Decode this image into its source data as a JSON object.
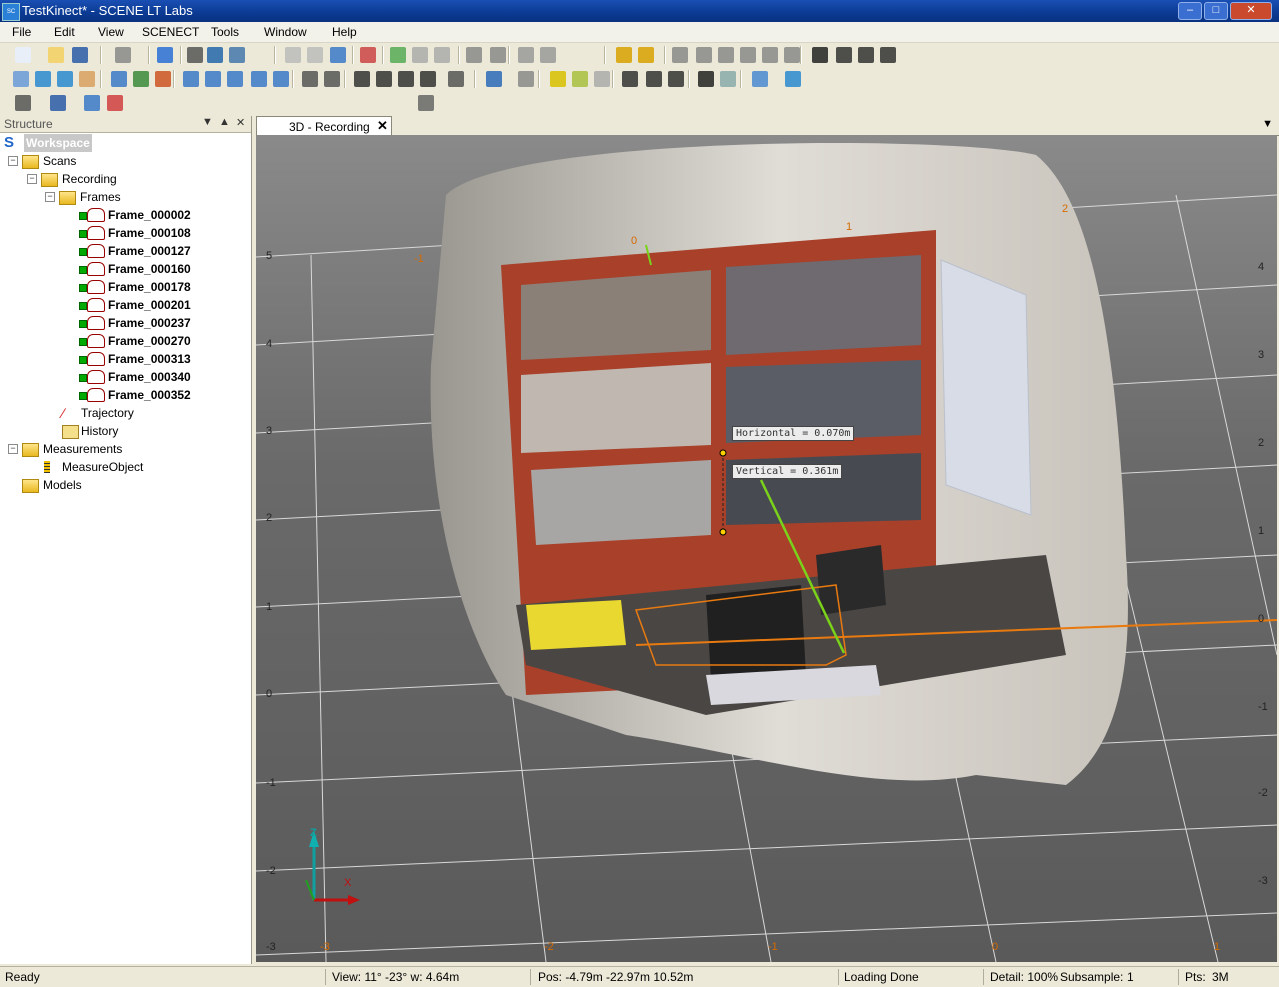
{
  "window": {
    "title": "TestKinect* - SCENE LT Labs",
    "controls": {
      "minimize": "–",
      "maximize": "□",
      "close": "✕"
    }
  },
  "menu": [
    "File",
    "Edit",
    "View",
    "SCENECT",
    "Tools",
    "Window",
    "Help"
  ],
  "structure_panel": {
    "header": "Structure",
    "workspace_label": "Workspace",
    "scans": "Scans",
    "recording": "Recording",
    "frames": "Frames",
    "frame_items": [
      "Frame_000002",
      "Frame_000108",
      "Frame_000127",
      "Frame_000160",
      "Frame_000178",
      "Frame_000201",
      "Frame_000237",
      "Frame_000270",
      "Frame_000313",
      "Frame_000340",
      "Frame_000352"
    ],
    "trajectory": "Trajectory",
    "history": "History",
    "measurements": "Measurements",
    "measure_object": "MeasureObject",
    "models": "Models"
  },
  "tabs": {
    "active_label": "3D - Recording",
    "close_glyph": "✕"
  },
  "viewport": {
    "measurements": {
      "horizontal": "Horizontal = 0.070m",
      "vertical": "Vertical = 0.361m"
    },
    "left_axis_labels": [
      "5",
      "4",
      "3",
      "2",
      "1",
      "0",
      "-1",
      "-2",
      "-3"
    ],
    "right_axis_labels": [
      "4",
      "3",
      "2",
      "1",
      "0",
      "-1",
      "-2",
      "-3"
    ],
    "bottom_axis_labels": [
      "-3",
      "-2",
      "-1",
      "0",
      "1"
    ],
    "top_axis_labels": [
      "-1",
      "0",
      "1",
      "2"
    ],
    "gizmo_z": "Z",
    "gizmo_x": "X"
  },
  "statusbar": {
    "state": "Ready",
    "view": "View: 11° -23° w: 4.64m",
    "pos": "Pos: -4.79m -22.97m 10.52m",
    "loading": "Loading Done",
    "detail": "Detail: 100%",
    "subsample_label": "Subsample:",
    "subsample_value": "1",
    "pts": "Pts:",
    "pts_value": "3M"
  },
  "colors": {
    "title_blue": "#0b3a93",
    "measure_orange": "#e87a10",
    "measure_green": "#7ad21a",
    "shelf_red": "#a8402a"
  }
}
